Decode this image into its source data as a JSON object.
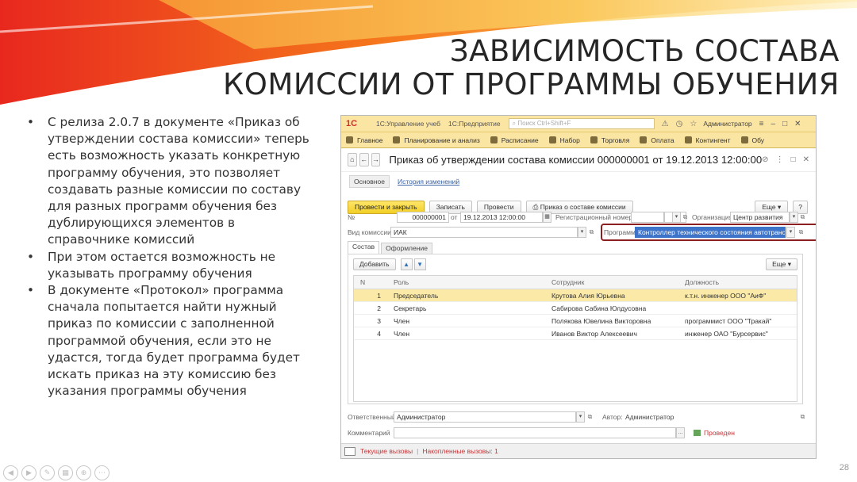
{
  "slide": {
    "title_line1": "ЗАВИСИМОСТЬ СОСТАВА",
    "title_line2": "КОМИССИИ  ОТ ПРОГРАММЫ ОБУЧЕНИЯ",
    "bullets": [
      "С релиза 2.0.7 в документе «Приказ об утверждении состава комиссии» теперь есть возможность указать конкретную программу обучения, это позволяет создавать разные комиссии по составу для разных программ обучения без дублирующихся элементов в справочнике комиссий",
      "При этом остается возможность не указывать программу обучения",
      "В документе «Протокол» программа сначала попытается найти нужный приказ по комиссии с заполненной программой обучения, если это не удастся, тогда будет программа будет искать приказ на эту комиссию без указания программы обучения"
    ],
    "slide_number": "28"
  },
  "window": {
    "logo": "1С",
    "title_app": "1С:Управление учеб",
    "title_platform": "1С:Предприятие",
    "search_placeholder": "Поиск Ctrl+Shift+F",
    "user": "Администратор",
    "sections": [
      "Главное",
      "Планирование и анализ",
      "Расписание",
      "Набор",
      "Торговля",
      "Оплата",
      "Контингент",
      "Обу"
    ],
    "document_title": "Приказ об утверждении состава комиссии 000000001 от 19.12.2013 12:00:00",
    "tabs": {
      "main": "Основное",
      "history": "История изменений"
    },
    "commands": {
      "post_close": "Провести и закрыть",
      "save": "Записать",
      "post": "Провести",
      "print_order": "Приказ о составе комиссии",
      "more": "Еще",
      "help": "?"
    },
    "fields": {
      "number_label": "№",
      "number_value": "000000001",
      "date_label": "от",
      "date_value": "19.12.2013 12:00:00",
      "reg_label": "Регистрационный номер",
      "reg_value": "",
      "org_label": "Организация",
      "org_value": "Центр развития",
      "kind_label": "Вид комиссии",
      "kind_value": "ИАК",
      "program_label": "Программа",
      "program_value": "Контроллер технического состояния автотранспорт"
    },
    "inner_tabs": [
      "Состав",
      "Оформление"
    ],
    "inner_commands": {
      "add": "Добавить",
      "more": "Еще"
    },
    "table": {
      "headers": {
        "n": "N",
        "role": "Роль",
        "employee": "Сотрудник",
        "position": "Должность"
      },
      "rows": [
        {
          "n": "1",
          "role": "Председатель",
          "employee": "Крутова Алия Юрьевна",
          "position": "к.т.н. инженер ООО \"АиФ\""
        },
        {
          "n": "2",
          "role": "Секретарь",
          "employee": "Сабирова Сабина Юлдусовна",
          "position": ""
        },
        {
          "n": "3",
          "role": "Член",
          "employee": "Полякова Ювелина Викторовна",
          "position": "программист ООО \"Тракай\""
        },
        {
          "n": "4",
          "role": "Член",
          "employee": "Иванов Виктор Алексеевич",
          "position": "инженер ОАО \"Бурсервис\""
        }
      ]
    },
    "footer": {
      "responsible_label": "Ответственный",
      "responsible_value": "Администратор",
      "author_label": "Автор:",
      "author_value": "Администратор",
      "comment_label": "Комментарий",
      "comment_value": "",
      "posted_status": "Проведен"
    },
    "statusbar": {
      "current_calls": "Текущие вызовы",
      "accumulated_calls": "Накопленные вызовы: 1"
    }
  },
  "colors": {
    "header_yellow": "#fbe5a3",
    "primary_button": "#f2cf25",
    "highlight_box": "#8c1f1f",
    "selected_row": "#fbeaa7"
  }
}
